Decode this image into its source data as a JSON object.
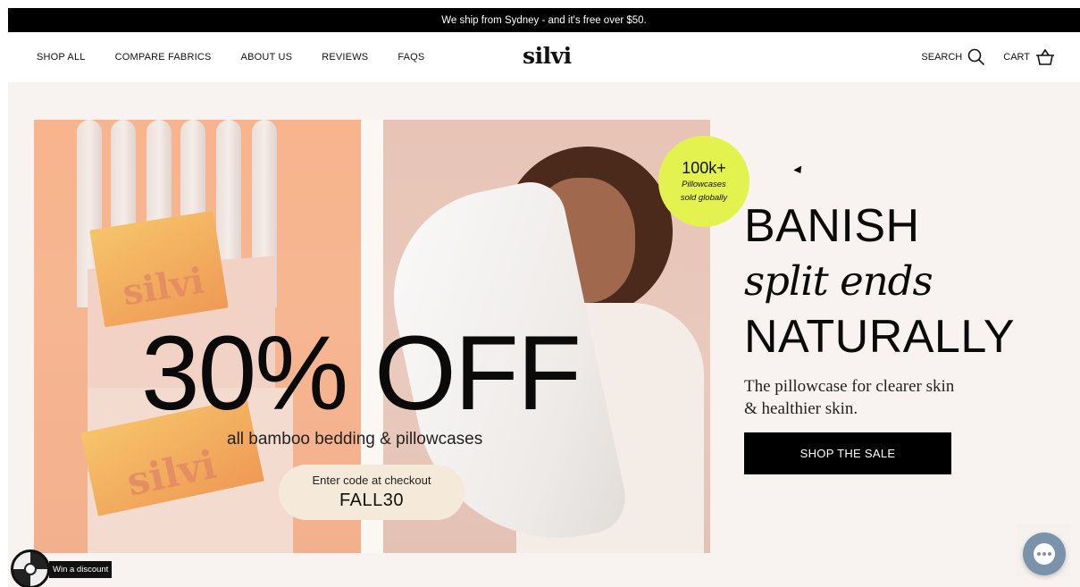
{
  "announcement": {
    "text": "We ship from Sydney - and it's free over $50."
  },
  "header": {
    "nav": [
      {
        "label": "SHOP ALL"
      },
      {
        "label": "COMPARE FABRICS"
      },
      {
        "label": "ABOUT US"
      },
      {
        "label": "REVIEWS"
      },
      {
        "label": "FAQS"
      }
    ],
    "logo": "silvi",
    "search_label": "SEARCH",
    "cart_label": "CART"
  },
  "hero": {
    "banner": {
      "headline": "30% OFF",
      "subheadline": "all bamboo bedding & pillowcases",
      "code_label": "Enter code at checkout",
      "code": "FALL30",
      "box_brand": "silvi",
      "badge_big": "100k+",
      "badge_line1": "Pillowcases",
      "badge_line2": "sold globally"
    },
    "copy": {
      "line1": "BANISH",
      "line2": "split ends",
      "line3": "NATURALLY",
      "desc_line1": "The pillowcase for clearer skin",
      "desc_line2": "& healthier skin.",
      "cta": "SHOP THE SALE"
    }
  },
  "widgets": {
    "discount_label": "Win a discount",
    "chat_icon": "chat-bubble-icon"
  },
  "colors": {
    "accent": "#000000",
    "badge": "#e4f24f",
    "hero_bg": "#f8f3f0",
    "code_pill": "#f5ead9"
  }
}
